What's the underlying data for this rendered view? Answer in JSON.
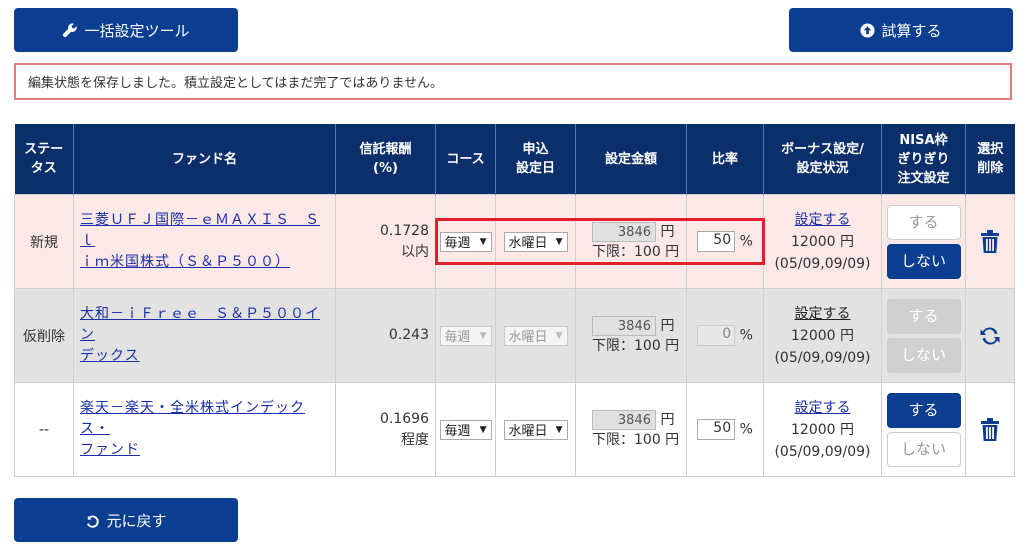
{
  "toolbar": {
    "bulk_label": "一括設定ツール",
    "calc_label": "試算する",
    "back_label": "元に戻す"
  },
  "notice": "編集状態を保存しました。積立設定としてはまだ完了ではありません。",
  "columns": {
    "status": "ステータス",
    "fund": "ファンド名",
    "fee": "信託報酬(%)",
    "course": "コース",
    "date": "申込設定日",
    "amount": "設定金額",
    "ratio": "比率",
    "bonus": "ボーナス設定/設定状況",
    "nisa": "NISA枠ぎりぎり注文設定",
    "action": "選択削除"
  },
  "rows": [
    {
      "status": "新規",
      "fund_line1": "三菱ＵＦＪ国際－ｅＭＡＸＩＳ　Ｓｌ",
      "fund_line2": "ｉｍ米国株式（Ｓ＆Ｐ５００）",
      "fee": "0.1728",
      "fee_note": "以内",
      "course": "毎週",
      "date": "水曜日",
      "amount": "3846",
      "yen": "円",
      "min": "下限：100 円",
      "ratio": "50",
      "pct": "%",
      "bonus_link": "設定する",
      "bonus_amount": "12000 円",
      "bonus_dates": "(05/09,09/09)",
      "nisa_on": "する",
      "nisa_off": "しない",
      "action_icon": "trash-icon"
    },
    {
      "status": "仮削除",
      "fund_line1": "大和－ｉＦｒｅｅ　Ｓ＆Ｐ５００イン",
      "fund_line2": "デックス",
      "fee": "0.243",
      "fee_note": "",
      "course": "毎週",
      "date": "水曜日",
      "amount": "3846",
      "yen": "円",
      "min": "下限：100 円",
      "ratio": "0",
      "pct": "%",
      "bonus_link": "設定する",
      "bonus_amount": "12000 円",
      "bonus_dates": "(05/09,09/09)",
      "nisa_on": "する",
      "nisa_off": "しない",
      "action_icon": "restore-icon"
    },
    {
      "status": "--",
      "fund_line1": "楽天－楽天・全米株式インデックス・",
      "fund_line2": "ファンド",
      "fee": "0.1696",
      "fee_note": "程度",
      "course": "毎週",
      "date": "水曜日",
      "amount": "3846",
      "yen": "円",
      "min": "下限：100 円",
      "ratio": "50",
      "pct": "%",
      "bonus_link": "設定する",
      "bonus_amount": "12000 円",
      "bonus_dates": "(05/09,09/09)",
      "nisa_on": "する",
      "nisa_off": "しない",
      "action_icon": "trash-icon"
    }
  ],
  "colors": {
    "navy": "#0b3d91",
    "header": "#0b2f6b",
    "new_row": "#fde8e8",
    "deleted_row": "#e2e2e2",
    "highlight": "#e0202a",
    "notice_border": "#e77a7a"
  }
}
